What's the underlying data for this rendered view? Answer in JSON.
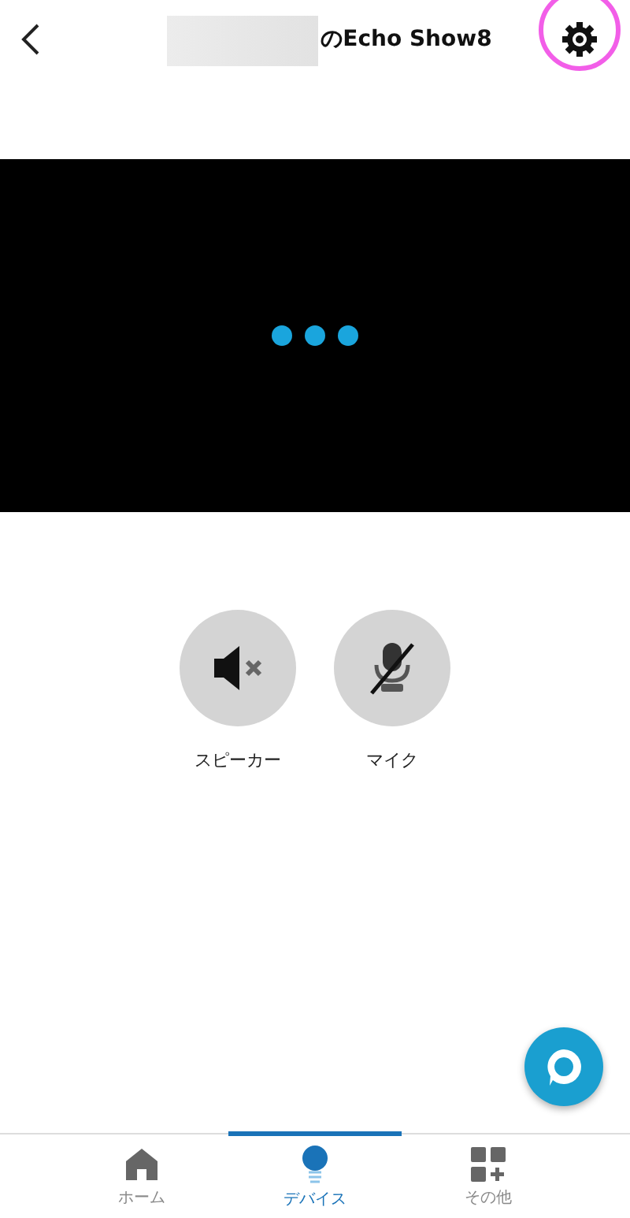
{
  "header": {
    "title": "のEcho Show8",
    "redacted": true,
    "highlight_settings": true
  },
  "controls": [
    {
      "kind": "speaker",
      "label": "スピーカー",
      "muted": true
    },
    {
      "kind": "mic",
      "label": "マイク",
      "muted": true
    }
  ],
  "tabs": [
    {
      "kind": "home",
      "label": "ホーム",
      "selected": false
    },
    {
      "kind": "devices",
      "label": "デバイス",
      "selected": true
    },
    {
      "kind": "more",
      "label": "その他",
      "selected": false
    }
  ]
}
